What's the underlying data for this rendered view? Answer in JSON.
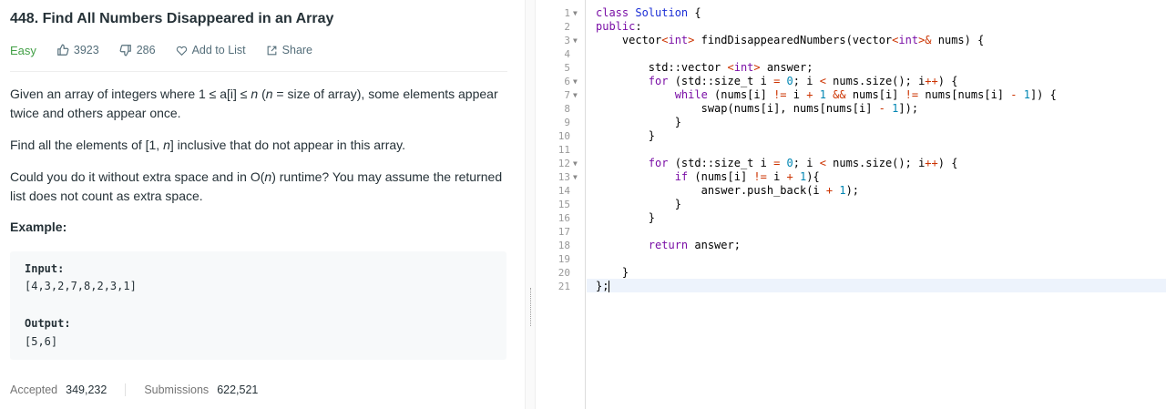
{
  "problem": {
    "title": "448. Find All Numbers Disappeared in an Array",
    "difficulty": "Easy",
    "likes": "3923",
    "dislikes": "286",
    "add_to_list": "Add to List",
    "share": "Share",
    "desc1a": "Given an array of integers where 1 ≤ a[i] ≤ ",
    "desc1n": "n",
    "desc1b": " (",
    "desc1n2": "n",
    "desc1c": " = size of array), some elements appear twice and others appear once.",
    "desc2a": "Find all the elements of [1, ",
    "desc2n": "n",
    "desc2b": "] inclusive that do not appear in this array.",
    "desc3a": "Could you do it without extra space and in O(",
    "desc3n": "n",
    "desc3b": ") runtime? You may assume the returned list does not count as extra space.",
    "example_heading": "Example:",
    "input_label": "Input:",
    "input_value": "[4,3,2,7,8,2,3,1]",
    "output_label": "Output:",
    "output_value": "[5,6]",
    "accepted_label": "Accepted",
    "accepted_value": "349,232",
    "submissions_label": "Submissions",
    "submissions_value": "622,521"
  },
  "editor": {
    "line_numbers": [
      "1",
      "2",
      "3",
      "4",
      "5",
      "6",
      "7",
      "8",
      "9",
      "10",
      "11",
      "12",
      "13",
      "14",
      "15",
      "16",
      "17",
      "18",
      "19",
      "20",
      "21"
    ],
    "fold_marker": "▼"
  }
}
